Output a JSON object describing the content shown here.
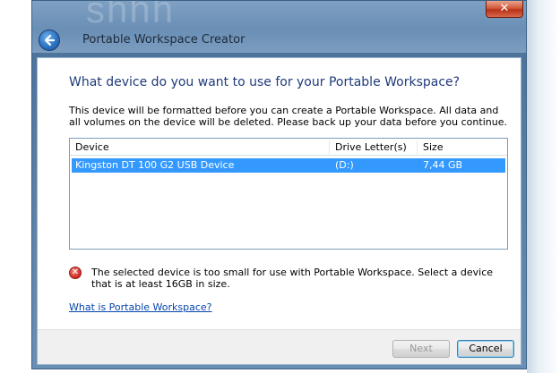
{
  "window": {
    "title": "Portable Workspace Creator",
    "background_text": "shhh",
    "close_glyph": "✕"
  },
  "page": {
    "heading": "What device do you want to use for your Portable Workspace?",
    "description": "This device will be formatted before you can create a Portable Workspace. All data and all volumes on the device will be deleted. Please back up your data before you continue."
  },
  "device_list": {
    "columns": [
      "Device",
      "Drive Letter(s)",
      "Size"
    ],
    "rows": [
      {
        "device": "Kingston DT 100 G2 USB Device",
        "drive": "(D:)",
        "size": "7,44 GB",
        "selected": true
      }
    ]
  },
  "error": {
    "icon": "error-x-icon",
    "message": "The selected device is too small for use with Portable Workspace. Select a device that is at least 16GB in size."
  },
  "help_link": "What is Portable Workspace?",
  "buttons": {
    "next": "Next",
    "cancel": "Cancel"
  },
  "colors": {
    "selection": "#3399ff",
    "heading": "#1f3a7a",
    "link": "#0645ad",
    "error": "#d6332a"
  }
}
